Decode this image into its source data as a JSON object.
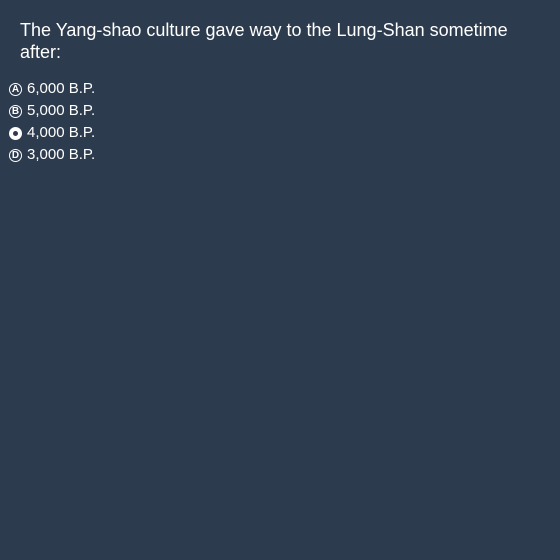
{
  "question": {
    "text": "The Yang-shao culture gave way to the Lung-Shan sometime after:"
  },
  "options": [
    {
      "letter": "A",
      "label": "6,000 B.P.",
      "selected": false
    },
    {
      "letter": "B",
      "label": "5,000 B.P.",
      "selected": false
    },
    {
      "letter": "C",
      "label": "4,000 B.P.",
      "selected": true
    },
    {
      "letter": "D",
      "label": "3,000 B.P.",
      "selected": false
    }
  ],
  "colors": {
    "background": "#2d3b4e",
    "text": "#ffffff"
  }
}
